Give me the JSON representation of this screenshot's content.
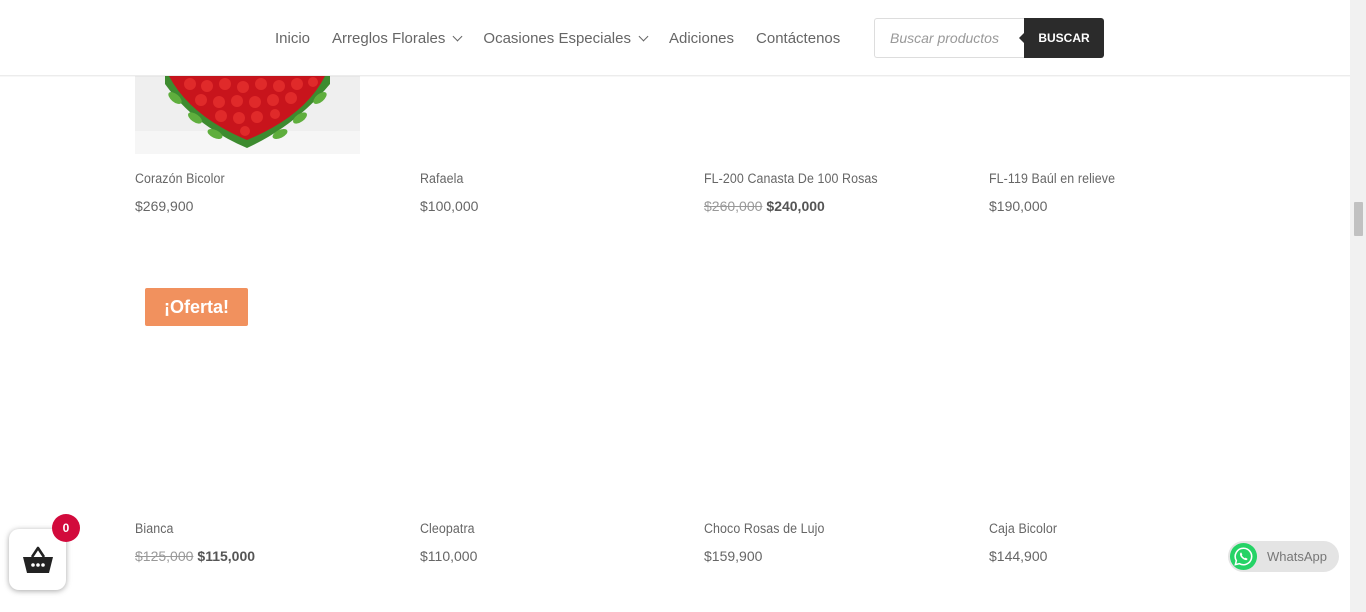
{
  "nav": {
    "items": [
      {
        "label": "Inicio",
        "dropdown": false
      },
      {
        "label": "Arreglos Florales",
        "dropdown": true
      },
      {
        "label": "Ocasiones Especiales",
        "dropdown": true
      },
      {
        "label": "Adiciones",
        "dropdown": false
      },
      {
        "label": "Contáctenos",
        "dropdown": false
      }
    ]
  },
  "search": {
    "placeholder": "Buscar productos",
    "button_label": "BUSCAR"
  },
  "products": [
    {
      "name": "Corazón Bicolor",
      "price": "$269,900",
      "old_price": "",
      "sale_price": ""
    },
    {
      "name": "Rafaela",
      "price": "$100,000",
      "old_price": "",
      "sale_price": ""
    },
    {
      "name": "FL-200 Canasta De 100 Rosas",
      "price": "",
      "old_price": "$260,000",
      "sale_price": "$240,000"
    },
    {
      "name": "FL-119 Baúl en relieve",
      "price": "$190,000",
      "old_price": "",
      "sale_price": ""
    },
    {
      "name": "Bianca",
      "price": "",
      "old_price": "$125,000",
      "sale_price": "$115,000"
    },
    {
      "name": "Cleopatra",
      "price": "$110,000",
      "old_price": "",
      "sale_price": ""
    },
    {
      "name": "Choco Rosas de Lujo",
      "price": "$159,900",
      "old_price": "",
      "sale_price": ""
    },
    {
      "name": "Caja Bicolor",
      "price": "$144,900",
      "old_price": "",
      "sale_price": ""
    }
  ],
  "badge": {
    "label": "¡Oferta!"
  },
  "cart": {
    "count": "0",
    "icon": "basket-icon"
  },
  "whatsapp": {
    "label": "WhatsApp",
    "icon": "whatsapp-icon"
  },
  "colors": {
    "badge": "#f1915e",
    "cart_count": "#d20a3c",
    "search_button": "#2b2b2b",
    "whatsapp_green": "#25d366"
  }
}
